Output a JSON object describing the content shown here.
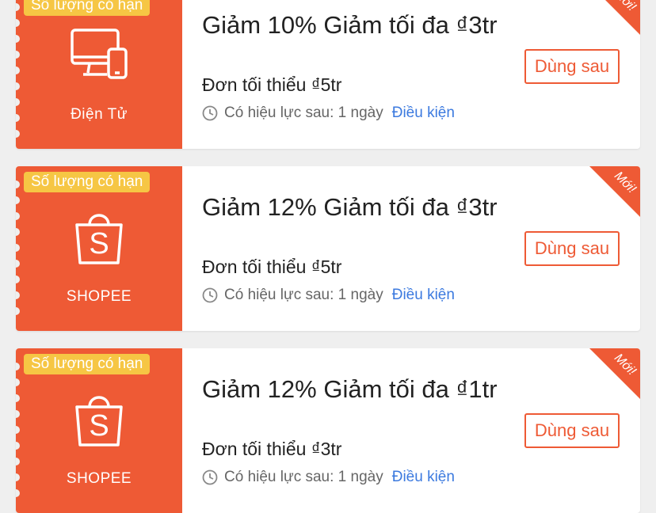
{
  "colors": {
    "accent": "#ee5a35",
    "badge": "#f6c644",
    "link": "#3c7adf"
  },
  "vouchers": [
    {
      "limited": "Số lượng có hạn",
      "icon": "electronics-icon",
      "category": "Điện Tử",
      "title": "Giảm 10% Giảm tối đa ₫3tr",
      "min_order": "Đơn tối thiểu ₫5tr",
      "validity": "Có hiệu lực sau: 1 ngày",
      "terms": "Điều kiện",
      "button": "Dùng sau",
      "new_label": "Mới!"
    },
    {
      "limited": "Số lượng có hạn",
      "icon": "shopee-bag-icon",
      "category": "SHOPEE",
      "title": "Giảm 12% Giảm tối đa ₫3tr",
      "min_order": "Đơn tối thiểu ₫5tr",
      "validity": "Có hiệu lực sau: 1 ngày",
      "terms": "Điều kiện",
      "button": "Dùng sau",
      "new_label": "Mới!"
    },
    {
      "limited": "Số lượng có hạn",
      "icon": "shopee-bag-icon",
      "category": "SHOPEE",
      "title": "Giảm 12% Giảm tối đa ₫1tr",
      "min_order": "Đơn tối thiểu ₫3tr",
      "validity": "Có hiệu lực sau: 1 ngày",
      "terms": "Điều kiện",
      "button": "Dùng sau",
      "new_label": "Mới!"
    }
  ]
}
